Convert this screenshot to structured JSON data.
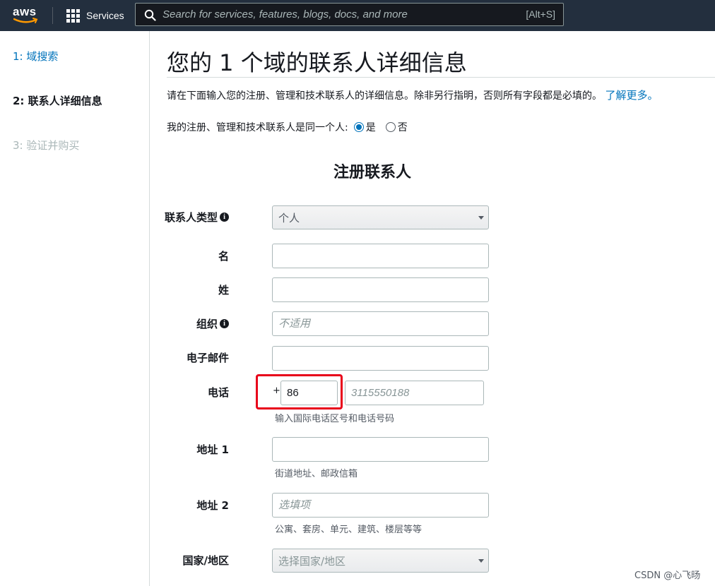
{
  "topnav": {
    "logo_text": "aws",
    "services_label": "Services",
    "search_placeholder": "Search for services, features, blogs, docs, and more",
    "search_shortcut": "[Alt+S]"
  },
  "sidebar": {
    "steps": [
      {
        "label": "1: 域搜索"
      },
      {
        "label": "2: 联系人详细信息"
      },
      {
        "label": "3: 验证并购买"
      }
    ]
  },
  "main": {
    "title": "您的 1 个域的联系人详细信息",
    "intro": "请在下面输入您的注册、管理和技术联系人的详细信息。除非另行指明，否则所有字段都是必填的。",
    "learn_more": "了解更多。",
    "same_person": {
      "label": "我的注册、管理和技术联系人是同一个人:",
      "yes": "是",
      "no": "否"
    },
    "section_title": "注册联系人",
    "form": {
      "contact_type": {
        "label": "联系人类型",
        "value": "个人"
      },
      "first_name": {
        "label": "名",
        "value": ""
      },
      "last_name": {
        "label": "姓",
        "value": ""
      },
      "organization": {
        "label": "组织",
        "placeholder": "不适用"
      },
      "email": {
        "label": "电子邮件",
        "value": ""
      },
      "phone": {
        "label": "电话",
        "plus": "+",
        "country_code": "86",
        "number_placeholder": "3115550188",
        "hint": "输入国际电话区号和电话号码"
      },
      "address1": {
        "label": "地址 1",
        "value": "",
        "hint": "街道地址、邮政信箱"
      },
      "address2": {
        "label": "地址 2",
        "placeholder": "选填项",
        "hint": "公寓、套房、单元、建筑、楼层等等"
      },
      "country": {
        "label": "国家/地区",
        "placeholder": "选择国家/地区"
      }
    }
  },
  "watermark": "CSDN @心飞旸",
  "colors": {
    "nav_bg": "#232f3e",
    "link": "#0073bb",
    "highlight": "#e8001a"
  }
}
